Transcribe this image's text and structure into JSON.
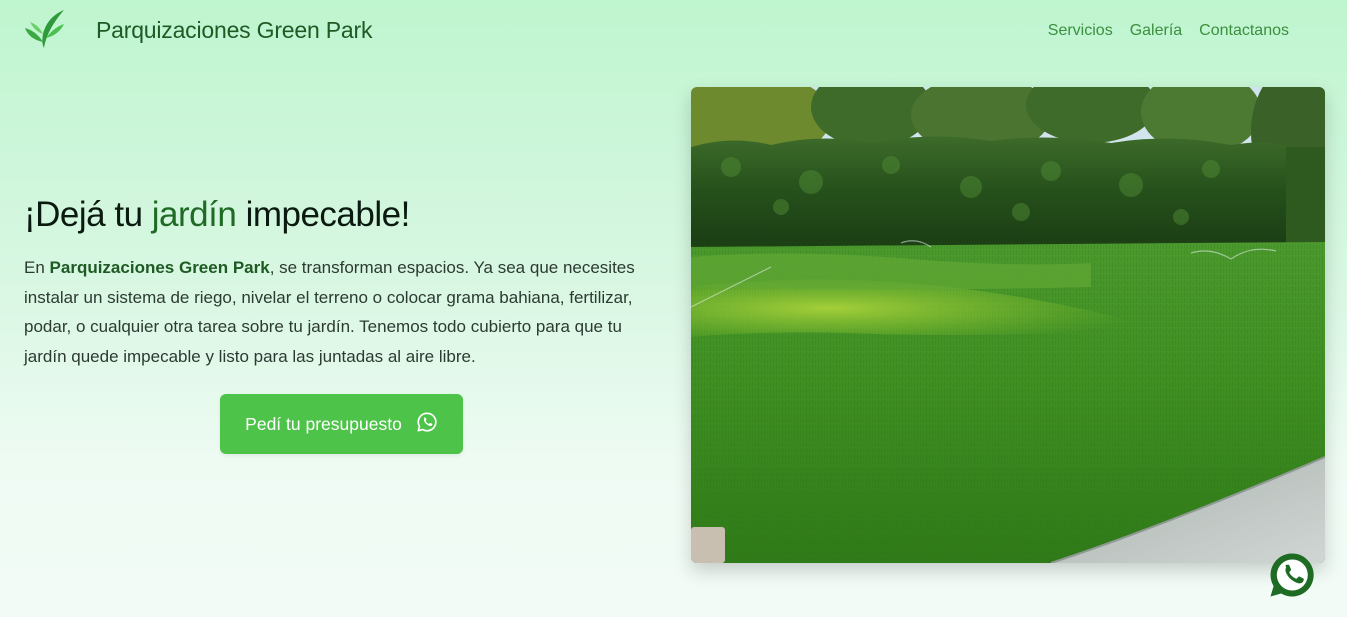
{
  "header": {
    "brand": "Parquizaciones Green Park",
    "logo_icon": "leaf-icon",
    "nav": [
      {
        "label": "Servicios"
      },
      {
        "label": "Galería"
      },
      {
        "label": "Contactanos"
      }
    ]
  },
  "hero": {
    "title_before": "¡Dejá tu ",
    "title_accent": "jardín",
    "title_after": " impecable!",
    "text_prefix": "En ",
    "text_brand": "Parquizaciones Green Park",
    "text_body": ", se transforman espacios. Ya sea que necesites instalar un sistema de riego, nivelar el terreno o colocar grama bahiana, fertilizar, podar, o cualquier otra tarea sobre tu jardín. Tenemos todo cubierto para que tu jardín quede impecable y listo para las juntadas al aire libre.",
    "cta_label": "Pedí tu presupuesto",
    "cta_icon": "whatsapp-icon"
  },
  "floating": {
    "icon": "whatsapp-icon"
  },
  "colors": {
    "brand": "#1e5a24",
    "nav": "#3b8f3f",
    "cta": "#4ec349",
    "fab": "#1e6b24"
  }
}
